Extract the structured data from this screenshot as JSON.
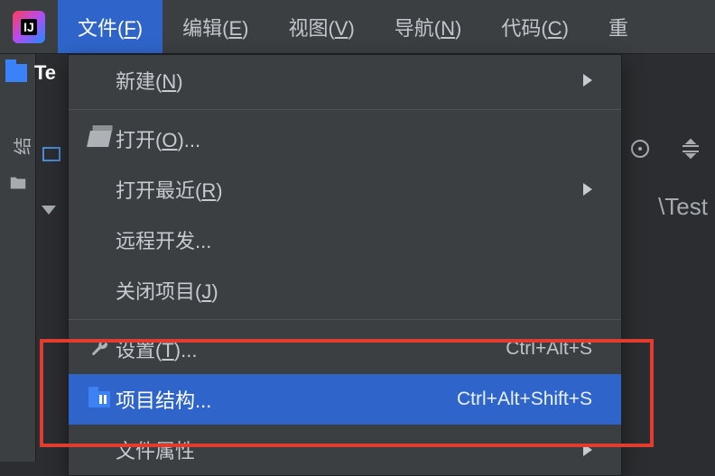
{
  "menubar": {
    "items": [
      {
        "pre": "文件(",
        "u": "F",
        "post": ")"
      },
      {
        "pre": "编辑(",
        "u": "E",
        "post": ")"
      },
      {
        "pre": "视图(",
        "u": "V",
        "post": ")"
      },
      {
        "pre": "导航(",
        "u": "N",
        "post": ")"
      },
      {
        "pre": "代码(",
        "u": "C",
        "post": ")"
      },
      {
        "pre": "重",
        "u": "",
        "post": ""
      }
    ],
    "active_index": 0
  },
  "project": {
    "name_fragment": "Te"
  },
  "breadcrumb_tail": "\\Test",
  "dropdown": {
    "groups": [
      [
        {
          "id": "new",
          "label_pre": "新建(",
          "label_u": "N",
          "label_post": ")",
          "icon": "",
          "shortcut": "",
          "submenu": true
        }
      ],
      [
        {
          "id": "open",
          "label_pre": "打开(",
          "label_u": "O",
          "label_post": ")...",
          "icon": "openfolder",
          "shortcut": "",
          "submenu": false
        },
        {
          "id": "open-recent",
          "label_pre": "打开最近(",
          "label_u": "R",
          "label_post": ")",
          "icon": "",
          "shortcut": "",
          "submenu": true
        },
        {
          "id": "remote-dev",
          "label_pre": "远程开发...",
          "label_u": "",
          "label_post": "",
          "icon": "",
          "shortcut": "",
          "submenu": false
        },
        {
          "id": "close-project",
          "label_pre": "关闭项目(",
          "label_u": "J",
          "label_post": ")",
          "icon": "",
          "shortcut": "",
          "submenu": false
        }
      ],
      [
        {
          "id": "settings",
          "label_pre": "设置(",
          "label_u": "T",
          "label_post": ")...",
          "icon": "wrench",
          "shortcut": "Ctrl+Alt+S",
          "submenu": false
        },
        {
          "id": "project-structure",
          "label_pre": "项目结构...",
          "label_u": "",
          "label_post": "",
          "icon": "bluefolder",
          "shortcut": "Ctrl+Alt+Shift+S",
          "submenu": false,
          "highlight": true
        },
        {
          "id": "file-properties",
          "label_pre": "文件属性",
          "label_u": "",
          "label_post": "",
          "icon": "",
          "shortcut": "",
          "submenu": true
        }
      ]
    ]
  }
}
